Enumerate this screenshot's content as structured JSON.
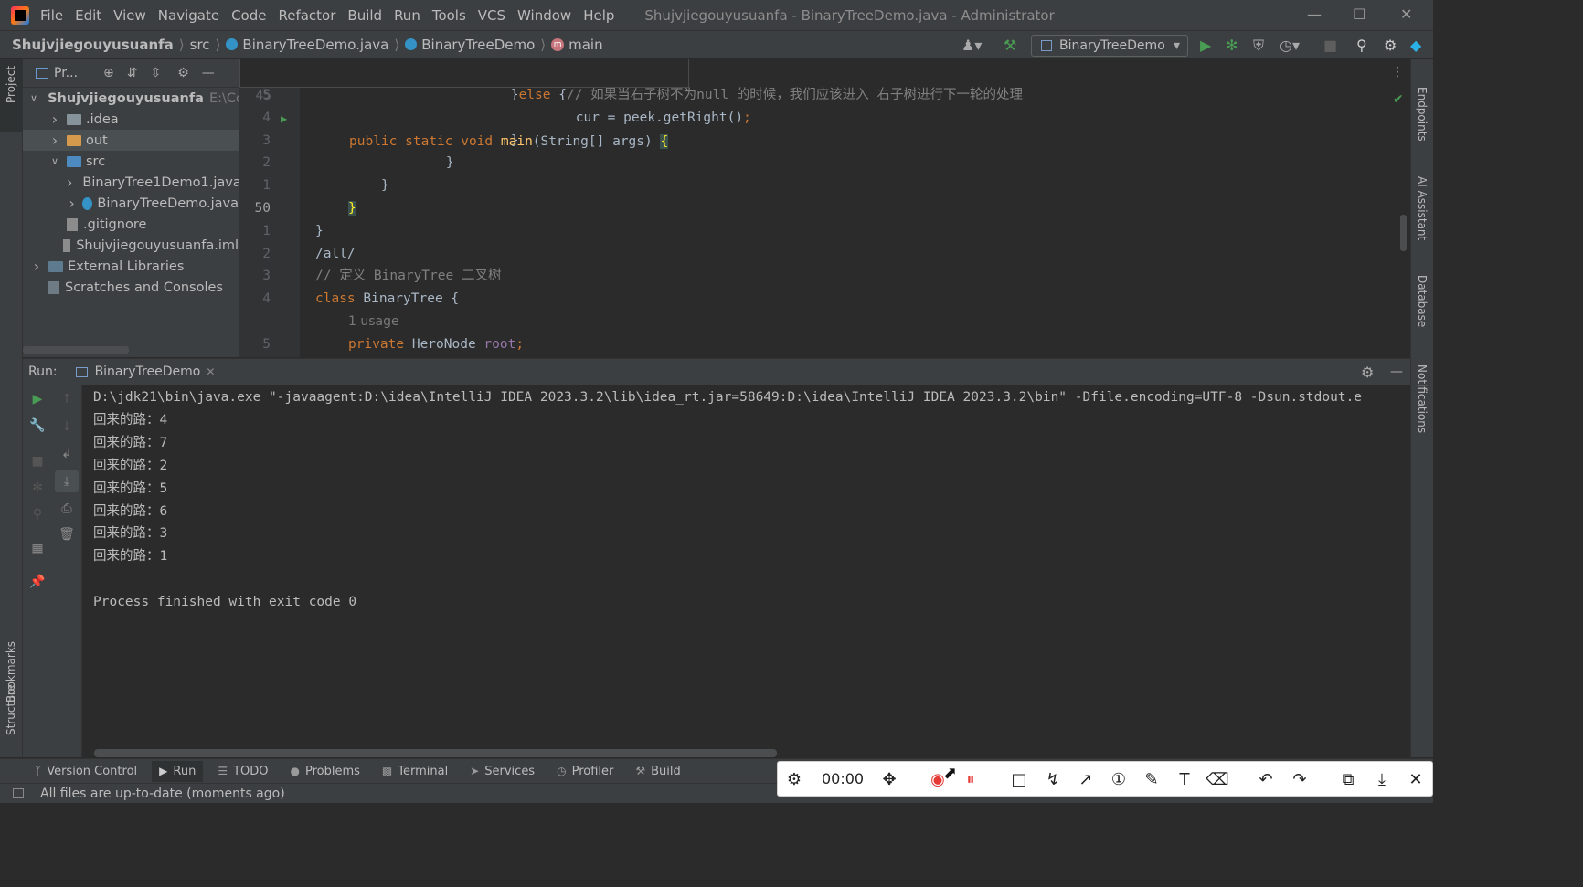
{
  "window": {
    "title": "Shujvjiegouyusuanfa - BinaryTreeDemo.java - Administrator",
    "menu": [
      "File",
      "Edit",
      "View",
      "Navigate",
      "Code",
      "Refactor",
      "Build",
      "Run",
      "Tools",
      "VCS",
      "Window",
      "Help"
    ]
  },
  "breadcrumb": {
    "project": "Shujvjiegouyusuanfa",
    "src": "src",
    "file": "BinaryTreeDemo.java",
    "class": "BinaryTreeDemo",
    "method": "main"
  },
  "toolbar": {
    "run_config": "BinaryTreeDemo"
  },
  "project_panel": {
    "title": "Pr...",
    "tree": [
      {
        "label": "Shujvjiegouyusuanfa",
        "hint": "E:\\Co",
        "level": 0,
        "kind": "module",
        "expanded": true
      },
      {
        "label": ".idea",
        "level": 1,
        "kind": "folder",
        "expanded": false
      },
      {
        "label": "out",
        "level": 1,
        "kind": "folder-orange",
        "expanded": false
      },
      {
        "label": "src",
        "level": 1,
        "kind": "folder-blue",
        "expanded": true
      },
      {
        "label": "BinaryTree1Demo1.java",
        "level": 2,
        "kind": "java",
        "expanded": false
      },
      {
        "label": "BinaryTreeDemo.java",
        "level": 2,
        "kind": "java",
        "expanded": false
      },
      {
        "label": ".gitignore",
        "level": 1,
        "kind": "file"
      },
      {
        "label": "Shujvjiegouyusuanfa.iml",
        "level": 1,
        "kind": "file"
      },
      {
        "label": "External Libraries",
        "level": 0,
        "kind": "lib",
        "expanded": false
      },
      {
        "label": "Scratches and Consoles",
        "level": 0,
        "kind": "scratch"
      }
    ]
  },
  "editor": {
    "sticky": {
      "line_no": "45",
      "code": "public static void main(String[] args) {"
    },
    "lines": [
      {
        "ln": "5",
        "parts": [
          {
            "t": "        }",
            "c": ""
          },
          {
            "t": "else ",
            "c": "kw"
          },
          {
            "t": "{",
            "c": ""
          },
          {
            "t": "// 如果当右子树不为null 的时候，我们应该进入 右子树进行下一轮的处理",
            "c": "cm"
          }
        ]
      },
      {
        "ln": "4",
        "parts": [
          {
            "t": "            cur = peek.getRight()",
            "c": ""
          },
          {
            "t": ";",
            "c": "kw"
          }
        ]
      },
      {
        "ln": "3",
        "parts": [
          {
            "t": "        }",
            "c": ""
          }
        ]
      },
      {
        "ln": "2",
        "parts": [
          {
            "t": "    }",
            "c": ""
          }
        ]
      },
      {
        "ln": "1",
        "parts": [
          {
            "t": "}",
            "c": ""
          }
        ]
      },
      {
        "ln": "50",
        "parts": [
          {
            "t": "}",
            "c": "brace"
          }
        ]
      },
      {
        "ln": "1",
        "parts": [
          {
            "t": "}",
            "c": ""
          }
        ]
      },
      {
        "ln": "2",
        "parts": [
          {
            "t": "/all/",
            "c": ""
          }
        ]
      },
      {
        "ln": "3",
        "parts": [
          {
            "t": "// 定义 BinaryTree 二叉树",
            "c": "cm"
          }
        ]
      },
      {
        "ln": "4",
        "parts": [
          {
            "t": "class ",
            "c": "kw"
          },
          {
            "t": "BinaryTree {",
            "c": ""
          }
        ]
      },
      {
        "ln": "",
        "parts": [
          {
            "t": "1 usage",
            "c": "hint"
          }
        ]
      },
      {
        "ln": "5",
        "parts": [
          {
            "t": "private ",
            "c": "kw"
          },
          {
            "t": "HeroNode ",
            "c": ""
          },
          {
            "t": "root",
            "c": "fld"
          },
          {
            "t": ";",
            "c": "kw"
          }
        ]
      }
    ]
  },
  "run_panel": {
    "label": "Run:",
    "tab": "BinaryTreeDemo",
    "output": [
      "D:\\jdk21\\bin\\java.exe \"-javaagent:D:\\idea\\IntelliJ IDEA 2023.3.2\\lib\\idea_rt.jar=58649:D:\\idea\\IntelliJ IDEA 2023.3.2\\bin\" -Dfile.encoding=UTF-8 -Dsun.stdout.e",
      "回来的路：4",
      "回来的路：7",
      "回来的路：2",
      "回来的路：5",
      "回来的路：6",
      "回来的路：3",
      "回来的路：1",
      "",
      "Process finished with exit code 0"
    ]
  },
  "bottom_tools": [
    "Version Control",
    "Run",
    "TODO",
    "Problems",
    "Terminal",
    "Services",
    "Profiler",
    "Build"
  ],
  "status": {
    "message": "All files are up-to-date (moments ago)"
  },
  "side_labels": {
    "left": [
      "Project",
      "Bookmarks",
      "Structure"
    ],
    "right": [
      "Endpoints",
      "AI Assistant",
      "Database",
      "Notifications"
    ]
  },
  "recorder": {
    "timer": "00:00"
  },
  "colors": {
    "accent_green": "#499c54",
    "keyword": "#cc7832",
    "function": "#ffc66d",
    "comment": "#808080",
    "record_red": "#e53935"
  }
}
